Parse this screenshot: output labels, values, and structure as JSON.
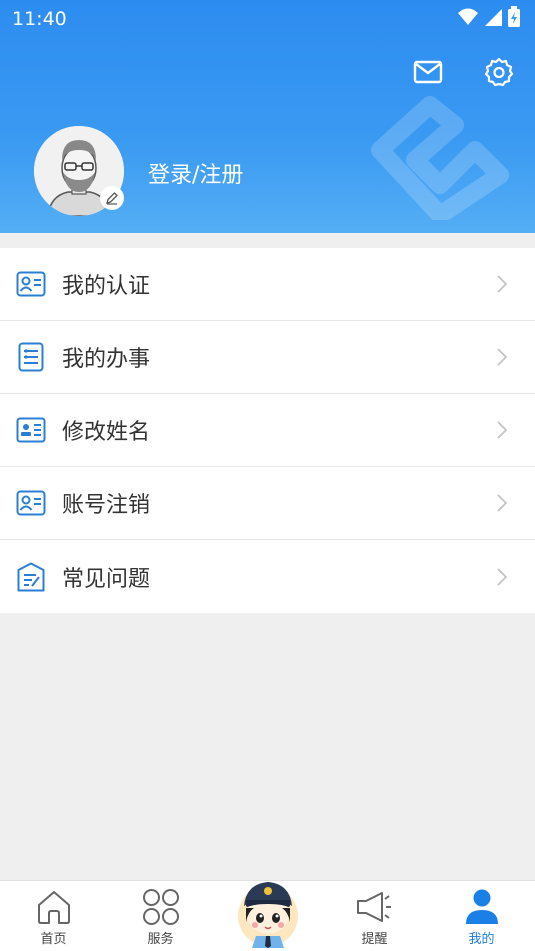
{
  "status_bar": {
    "time": "11:40"
  },
  "header": {
    "mail_icon": "mail-icon",
    "settings_icon": "gear-icon",
    "login_label": "登录/注册"
  },
  "menu": {
    "items": [
      {
        "label": "我的认证",
        "icon": "id-card-icon"
      },
      {
        "label": "我的办事",
        "icon": "list-icon"
      },
      {
        "label": "修改姓名",
        "icon": "name-card-icon"
      },
      {
        "label": "账号注销",
        "icon": "id-card-icon"
      },
      {
        "label": "常见问题",
        "icon": "faq-doc-icon"
      }
    ]
  },
  "bottom_nav": {
    "items": [
      {
        "label": "首页",
        "icon": "home-icon"
      },
      {
        "label": "服务",
        "icon": "services-icon"
      },
      {
        "label": "",
        "icon": "police-mascot-icon"
      },
      {
        "label": "提醒",
        "icon": "megaphone-icon"
      },
      {
        "label": "我的",
        "icon": "user-icon",
        "active": true
      }
    ]
  },
  "colors": {
    "accent": "#1b7fe8",
    "header_top": "#2d8cf0",
    "icon_blue": "#2a7fd4"
  }
}
